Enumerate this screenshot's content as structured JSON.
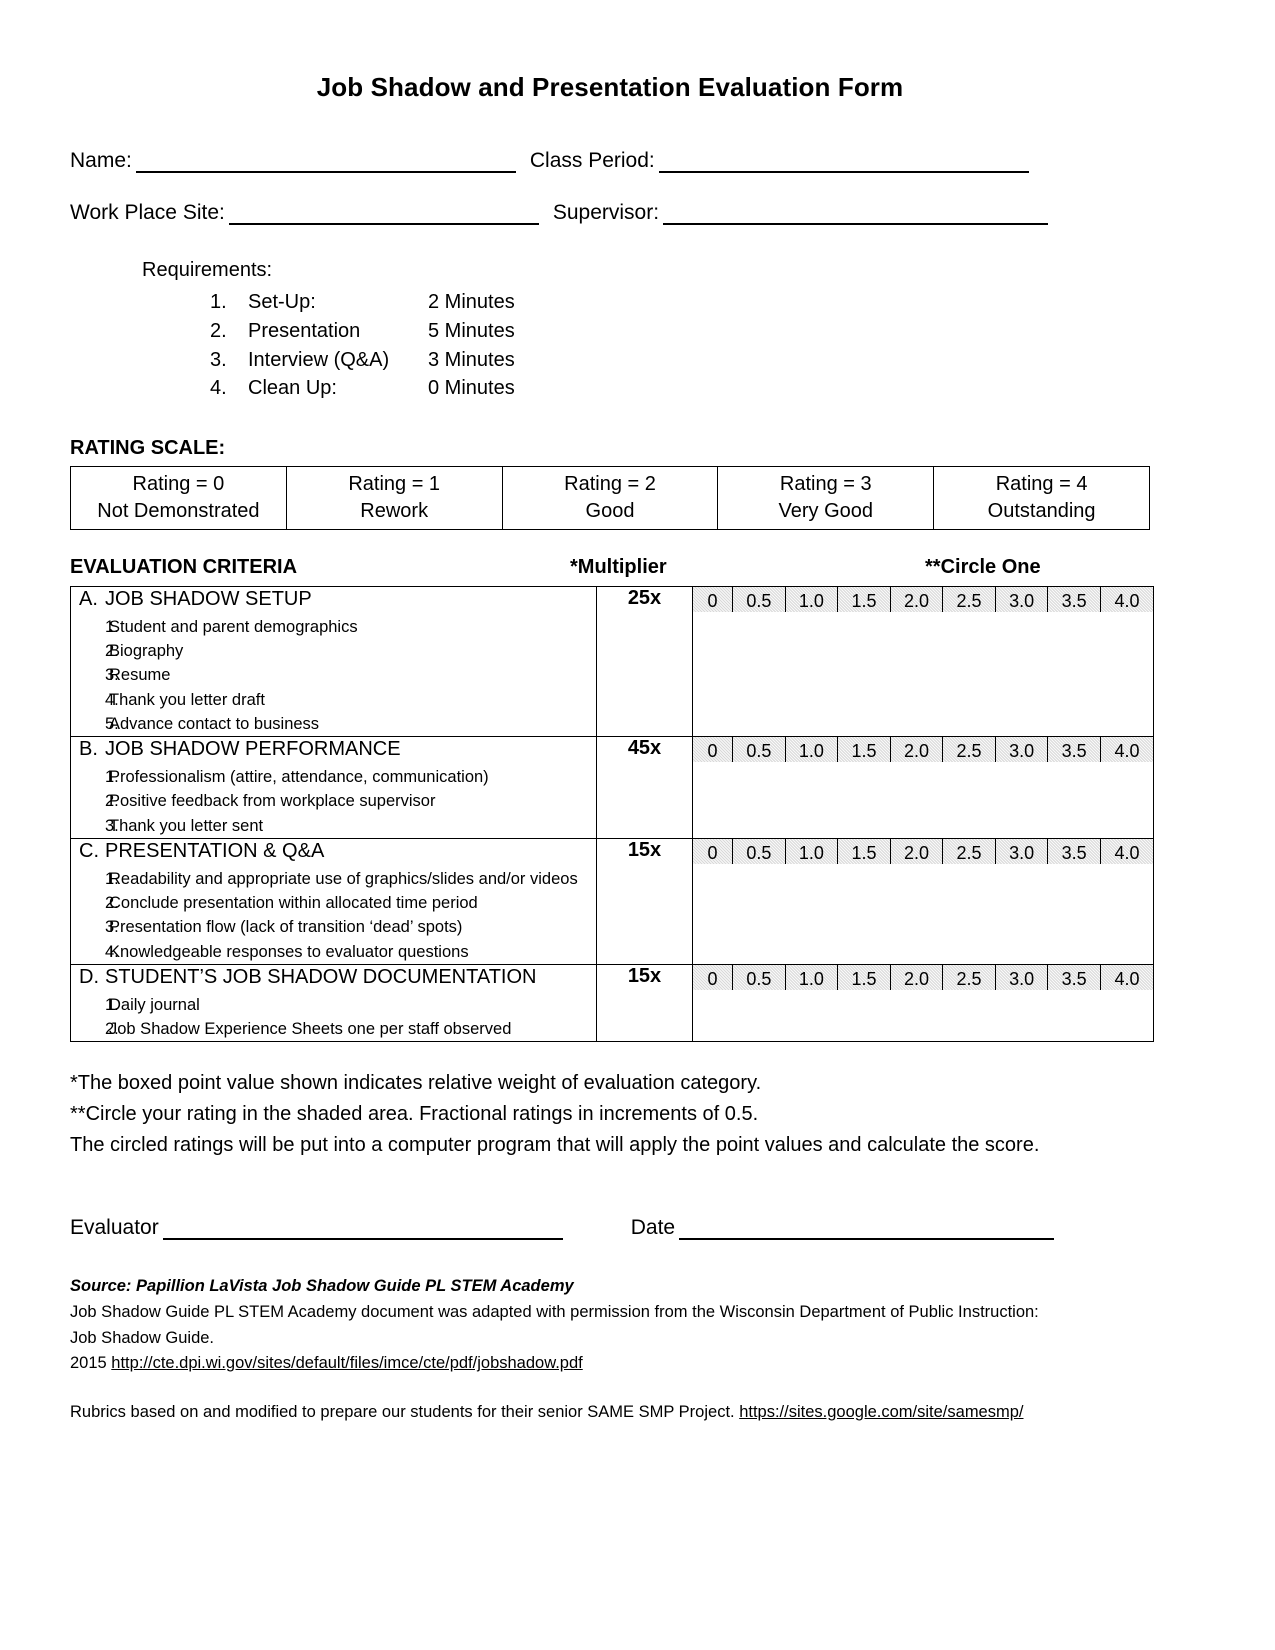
{
  "document": {
    "title": "Job Shadow and Presentation Evaluation Form"
  },
  "header_fields": {
    "name_label": "Name:",
    "class_period_label": "Class Period:",
    "work_place_site_label": "Work Place Site:",
    "supervisor_label": "Supervisor:",
    "name_value": "",
    "class_period_value": "",
    "work_place_site_value": "",
    "supervisor_value": ""
  },
  "requirements": {
    "heading": "Requirements:",
    "items": [
      {
        "num": "1.",
        "name": "Set-Up:",
        "time": "2 Minutes"
      },
      {
        "num": "2.",
        "name": "Presentation",
        "time": "5 Minutes"
      },
      {
        "num": "3.",
        "name": "Interview (Q&A)",
        "time": "3 Minutes"
      },
      {
        "num": "4.",
        "name": "Clean Up:",
        "time": "0 Minutes"
      }
    ]
  },
  "rating_scale": {
    "heading": "RATING SCALE:",
    "cells": [
      {
        "top": "Rating = 0",
        "bottom": "Not Demonstrated"
      },
      {
        "top": "Rating = 1",
        "bottom": "Rework"
      },
      {
        "top": "Rating = 2",
        "bottom": "Good"
      },
      {
        "top": "Rating = 3",
        "bottom": "Very Good"
      },
      {
        "top": "Rating = 4",
        "bottom": "Outstanding"
      }
    ]
  },
  "criteria_header": {
    "left": "EVALUATION CRITERIA",
    "middle": "*Multiplier",
    "right": "**Circle One"
  },
  "scale_values": [
    "0",
    "0.5",
    "1.0",
    "1.5",
    "2.0",
    "2.5",
    "3.0",
    "3.5",
    "4.0"
  ],
  "criteria": [
    {
      "letter": "A.",
      "name": "JOB SHADOW SETUP",
      "multiplier": "25x",
      "sub_items": [
        {
          "num": "1.",
          "text": "Student and parent demographics"
        },
        {
          "num": "2.",
          "text": "Biography"
        },
        {
          "num": "3.",
          "text": "Resume"
        },
        {
          "num": "4.",
          "text": "Thank you letter draft"
        },
        {
          "num": "5.",
          "text": "Advance contact to business"
        }
      ]
    },
    {
      "letter": "B.",
      "name": "JOB SHADOW PERFORMANCE",
      "multiplier": "45x",
      "sub_items": [
        {
          "num": "1.",
          "text": "Professionalism (attire, attendance, communication)"
        },
        {
          "num": "2.",
          "text": "Positive feedback from workplace supervisor"
        },
        {
          "num": "3.",
          "text": "Thank you letter sent"
        }
      ]
    },
    {
      "letter": "C.",
      "name": "PRESENTATION & Q&A",
      "multiplier": "15x",
      "sub_items": [
        {
          "num": "1.",
          "text": "Readability and appropriate use of graphics/slides and/or videos"
        },
        {
          "num": "2.",
          "text": "Conclude presentation within allocated time period"
        },
        {
          "num": "3.",
          "text": "Presentation flow (lack of transition ‘dead’ spots)"
        },
        {
          "num": "4.",
          "text": "Knowledgeable responses to evaluator questions"
        }
      ]
    },
    {
      "letter": "D.",
      "name": "STUDENT’S JOB SHADOW DOCUMENTATION",
      "multiplier": "15x",
      "sub_items": [
        {
          "num": "1.",
          "text": "Daily journal"
        },
        {
          "num": "2.",
          "text": "Job Shadow Experience Sheets one per staff observed"
        }
      ]
    }
  ],
  "footnotes": {
    "line1": "*The boxed point value shown indicates relative weight of evaluation category.",
    "line2": "**Circle your rating in the shaded area. Fractional ratings in increments of 0.5.",
    "line3": "The circled ratings will be put into a computer program that will apply the point values and calculate the score."
  },
  "signature": {
    "evaluator_label": "Evaluator",
    "date_label": "Date",
    "evaluator_value": "",
    "date_value": ""
  },
  "source": {
    "line1": "Source: Papillion LaVista Job Shadow Guide PL STEM Academy",
    "line2": "Job Shadow Guide PL STEM Academy document was adapted with permission from the Wisconsin Department of Public Instruction:",
    "line3": "Job Shadow Guide.",
    "year": "2015 ",
    "url": "http://cte.dpi.wi.gov/sites/default/files/imce/cte/pdf/jobshadow.pdf",
    "final_text": "Rubrics based on and modified to prepare our students for their senior SAME SMP Project. ",
    "final_url": "https://sites.google.com/site/samesmp/"
  }
}
